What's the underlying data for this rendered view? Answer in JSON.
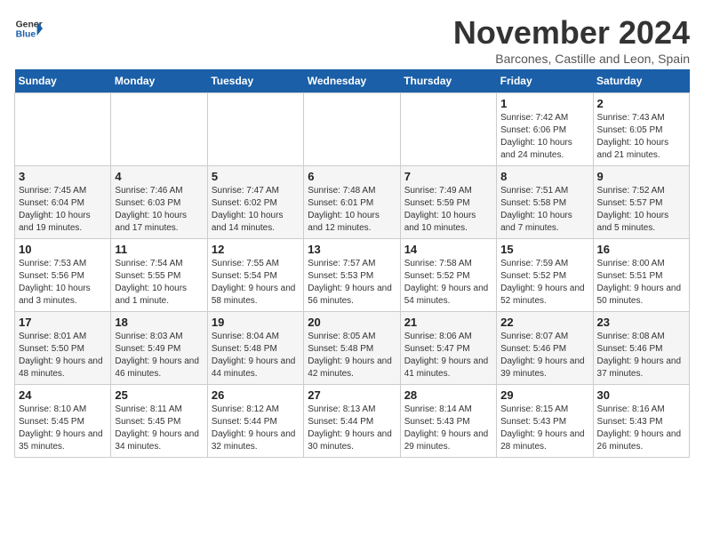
{
  "header": {
    "logo_line1": "General",
    "logo_line2": "Blue",
    "month_title": "November 2024",
    "location": "Barcones, Castille and Leon, Spain"
  },
  "weekdays": [
    "Sunday",
    "Monday",
    "Tuesday",
    "Wednesday",
    "Thursday",
    "Friday",
    "Saturday"
  ],
  "weeks": [
    [
      {
        "day": "",
        "info": ""
      },
      {
        "day": "",
        "info": ""
      },
      {
        "day": "",
        "info": ""
      },
      {
        "day": "",
        "info": ""
      },
      {
        "day": "",
        "info": ""
      },
      {
        "day": "1",
        "info": "Sunrise: 7:42 AM\nSunset: 6:06 PM\nDaylight: 10 hours and 24 minutes."
      },
      {
        "day": "2",
        "info": "Sunrise: 7:43 AM\nSunset: 6:05 PM\nDaylight: 10 hours and 21 minutes."
      }
    ],
    [
      {
        "day": "3",
        "info": "Sunrise: 7:45 AM\nSunset: 6:04 PM\nDaylight: 10 hours and 19 minutes."
      },
      {
        "day": "4",
        "info": "Sunrise: 7:46 AM\nSunset: 6:03 PM\nDaylight: 10 hours and 17 minutes."
      },
      {
        "day": "5",
        "info": "Sunrise: 7:47 AM\nSunset: 6:02 PM\nDaylight: 10 hours and 14 minutes."
      },
      {
        "day": "6",
        "info": "Sunrise: 7:48 AM\nSunset: 6:01 PM\nDaylight: 10 hours and 12 minutes."
      },
      {
        "day": "7",
        "info": "Sunrise: 7:49 AM\nSunset: 5:59 PM\nDaylight: 10 hours and 10 minutes."
      },
      {
        "day": "8",
        "info": "Sunrise: 7:51 AM\nSunset: 5:58 PM\nDaylight: 10 hours and 7 minutes."
      },
      {
        "day": "9",
        "info": "Sunrise: 7:52 AM\nSunset: 5:57 PM\nDaylight: 10 hours and 5 minutes."
      }
    ],
    [
      {
        "day": "10",
        "info": "Sunrise: 7:53 AM\nSunset: 5:56 PM\nDaylight: 10 hours and 3 minutes."
      },
      {
        "day": "11",
        "info": "Sunrise: 7:54 AM\nSunset: 5:55 PM\nDaylight: 10 hours and 1 minute."
      },
      {
        "day": "12",
        "info": "Sunrise: 7:55 AM\nSunset: 5:54 PM\nDaylight: 9 hours and 58 minutes."
      },
      {
        "day": "13",
        "info": "Sunrise: 7:57 AM\nSunset: 5:53 PM\nDaylight: 9 hours and 56 minutes."
      },
      {
        "day": "14",
        "info": "Sunrise: 7:58 AM\nSunset: 5:52 PM\nDaylight: 9 hours and 54 minutes."
      },
      {
        "day": "15",
        "info": "Sunrise: 7:59 AM\nSunset: 5:52 PM\nDaylight: 9 hours and 52 minutes."
      },
      {
        "day": "16",
        "info": "Sunrise: 8:00 AM\nSunset: 5:51 PM\nDaylight: 9 hours and 50 minutes."
      }
    ],
    [
      {
        "day": "17",
        "info": "Sunrise: 8:01 AM\nSunset: 5:50 PM\nDaylight: 9 hours and 48 minutes."
      },
      {
        "day": "18",
        "info": "Sunrise: 8:03 AM\nSunset: 5:49 PM\nDaylight: 9 hours and 46 minutes."
      },
      {
        "day": "19",
        "info": "Sunrise: 8:04 AM\nSunset: 5:48 PM\nDaylight: 9 hours and 44 minutes."
      },
      {
        "day": "20",
        "info": "Sunrise: 8:05 AM\nSunset: 5:48 PM\nDaylight: 9 hours and 42 minutes."
      },
      {
        "day": "21",
        "info": "Sunrise: 8:06 AM\nSunset: 5:47 PM\nDaylight: 9 hours and 41 minutes."
      },
      {
        "day": "22",
        "info": "Sunrise: 8:07 AM\nSunset: 5:46 PM\nDaylight: 9 hours and 39 minutes."
      },
      {
        "day": "23",
        "info": "Sunrise: 8:08 AM\nSunset: 5:46 PM\nDaylight: 9 hours and 37 minutes."
      }
    ],
    [
      {
        "day": "24",
        "info": "Sunrise: 8:10 AM\nSunset: 5:45 PM\nDaylight: 9 hours and 35 minutes."
      },
      {
        "day": "25",
        "info": "Sunrise: 8:11 AM\nSunset: 5:45 PM\nDaylight: 9 hours and 34 minutes."
      },
      {
        "day": "26",
        "info": "Sunrise: 8:12 AM\nSunset: 5:44 PM\nDaylight: 9 hours and 32 minutes."
      },
      {
        "day": "27",
        "info": "Sunrise: 8:13 AM\nSunset: 5:44 PM\nDaylight: 9 hours and 30 minutes."
      },
      {
        "day": "28",
        "info": "Sunrise: 8:14 AM\nSunset: 5:43 PM\nDaylight: 9 hours and 29 minutes."
      },
      {
        "day": "29",
        "info": "Sunrise: 8:15 AM\nSunset: 5:43 PM\nDaylight: 9 hours and 28 minutes."
      },
      {
        "day": "30",
        "info": "Sunrise: 8:16 AM\nSunset: 5:43 PM\nDaylight: 9 hours and 26 minutes."
      }
    ]
  ]
}
